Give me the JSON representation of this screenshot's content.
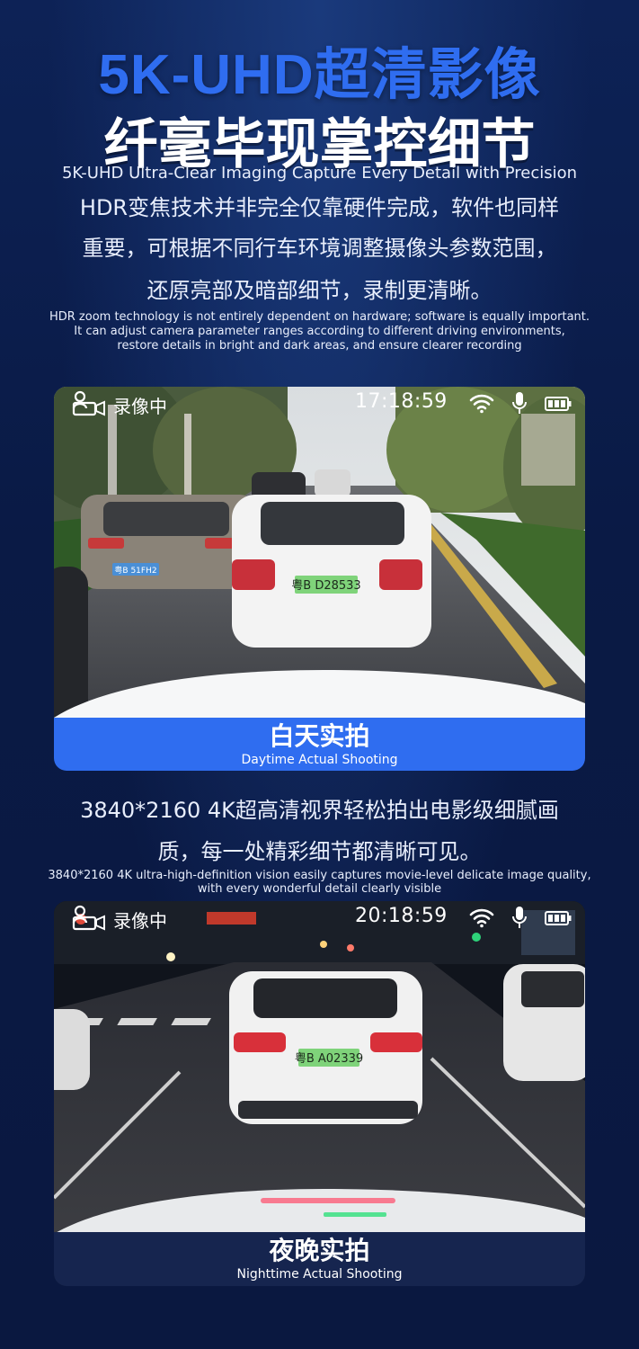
{
  "header": {
    "title": "5K-UHD超清影像",
    "subtitle": "纤毫毕现掌控细节",
    "subtitle_en": "5K-UHD Ultra-Clear Imaging Capture Every Detail with Precision"
  },
  "intro": {
    "cn_lines": [
      "HDR变焦技术并非完全仅靠硬件完成，软件也同样",
      "重要，可根据不同行车环境调整摄像头参数范围，",
      "还原亮部及暗部细节，录制更清晰。"
    ],
    "en_lines": [
      "HDR zoom technology is not entirely dependent on hardware; software is equally important.",
      "It can adjust camera parameter ranges according to different driving environments,",
      "restore details in bright and dark areas, and ensure clearer recording"
    ]
  },
  "day_panel": {
    "status_label": "录像中",
    "time": "17:18:59",
    "plate_center": "粤B D28533",
    "plate_left": "粤B 51FH2",
    "caption_cn": "白天实拍",
    "caption_en": "Daytime Actual Shooting"
  },
  "middle": {
    "cn_lines": [
      "3840*2160 4K超高清视界轻松拍出电影级细腻画",
      "质，每一处精彩细节都清晰可见。"
    ],
    "en_lines": [
      "3840*2160 4K ultra-high-definition vision easily captures movie-level delicate image quality,",
      "with every wonderful detail clearly visible"
    ]
  },
  "night_panel": {
    "status_label": "录像中",
    "time": "20:18:59",
    "plate_center": "粤B A02339",
    "caption_cn": "夜晚实拍",
    "caption_en": "Nighttime Actual Shooting"
  },
  "icons": {
    "recording": "camera-user-icon",
    "wifi": "wifi-icon",
    "mic": "microphone-icon",
    "battery": "battery-icon"
  },
  "colors": {
    "background": "#0a1a45",
    "headline_blue": "#2f6df0",
    "day_caption_bg": "#2f6df0",
    "night_caption_bg": "#16254f",
    "plate_green": "#7fd37a"
  }
}
